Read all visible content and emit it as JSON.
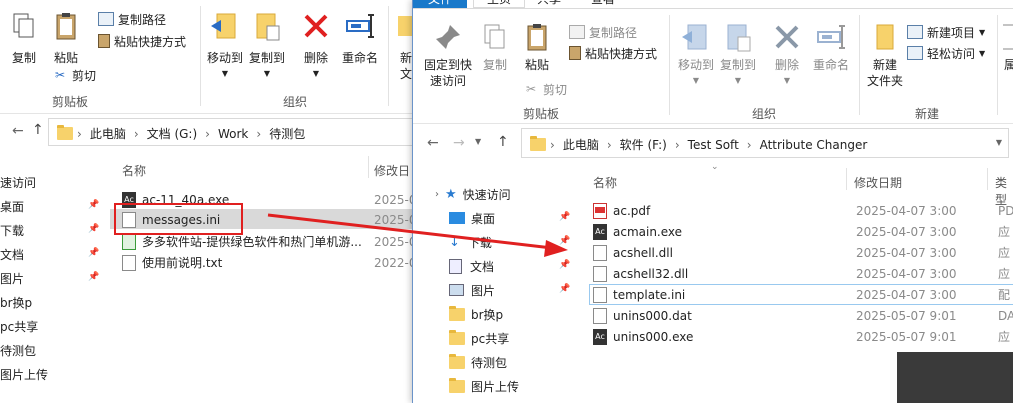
{
  "left_window": {
    "ribbon": {
      "copy": "复制",
      "paste": "粘贴",
      "copy_path": "复制路径",
      "paste_shortcut": "粘贴快捷方式",
      "cut": "剪切",
      "group_clipboard": "剪贴板",
      "move_to": "移动到",
      "copy_to": "复制到",
      "delete": "删除",
      "rename": "重命名",
      "new_partial": "新",
      "folder_partial": "文",
      "group_organize": "组织"
    },
    "address": [
      "此电脑",
      "文档 (G:)",
      "Work",
      "待测包"
    ],
    "nav_items": [
      "速访问",
      "桌面",
      "下载",
      "文档",
      "图片",
      "br换p",
      "pc共享",
      "待测包",
      "图片上传"
    ],
    "headers": {
      "name": "名称",
      "date": "修改日"
    },
    "files": [
      {
        "name": "ac-11_40a.exe",
        "date": "2025-0"
      },
      {
        "name": "messages.ini",
        "date": "2025-0"
      },
      {
        "name": "多多软件站-提供绿色软件和热门单机游...",
        "date": "2025-0"
      },
      {
        "name": "使用前说明.txt",
        "date": "2022-0"
      }
    ]
  },
  "right_window": {
    "tabs": {
      "file": "文件",
      "home": "主页",
      "share": "共享",
      "view": "查看"
    },
    "ribbon": {
      "pin_quick": "固定到快\n速访问",
      "copy": "复制",
      "paste": "粘贴",
      "copy_path": "复制路径",
      "paste_shortcut": "粘贴快捷方式",
      "cut": "剪切",
      "group_clipboard": "剪贴板",
      "move_to": "移动到",
      "copy_to": "复制到",
      "delete": "删除",
      "rename": "重命名",
      "group_organize": "组织",
      "new_folder": "新建\n文件夹",
      "new_item": "新建项目",
      "easy_access": "轻松访问",
      "group_new": "新建",
      "prop_partial": "属"
    },
    "address": [
      "此电脑",
      "软件 (F:)",
      "Test Soft",
      "Attribute Changer"
    ],
    "nav_items": [
      "快速访问",
      "桌面",
      "下载",
      "文档",
      "图片",
      "br换p",
      "pc共享",
      "待测包",
      "图片上传"
    ],
    "headers": {
      "name": "名称",
      "date": "修改日期",
      "type": "类型"
    },
    "files": [
      {
        "name": "ac.pdf",
        "date": "2025-04-07 3:00",
        "type": "PD",
        "icon": "pdf"
      },
      {
        "name": "acmain.exe",
        "date": "2025-04-07 3:00",
        "type": "应",
        "icon": "ac"
      },
      {
        "name": "acshell.dll",
        "date": "2025-04-07 3:00",
        "type": "应",
        "icon": "dll"
      },
      {
        "name": "acshell32.dll",
        "date": "2025-04-07 3:00",
        "type": "应",
        "icon": "dll"
      },
      {
        "name": "template.ini",
        "date": "2025-04-07 3:00",
        "type": "配",
        "icon": "ini"
      },
      {
        "name": "unins000.dat",
        "date": "2025-05-07 9:01",
        "type": "DA",
        "icon": "blank"
      },
      {
        "name": "unins000.exe",
        "date": "2025-05-07 9:01",
        "type": "应",
        "icon": "ac"
      }
    ]
  },
  "colors": {
    "accent": "#1979ca",
    "arrow": "#e02020",
    "highlight_box": "#e02020",
    "selected_row": "#cce8ff"
  }
}
